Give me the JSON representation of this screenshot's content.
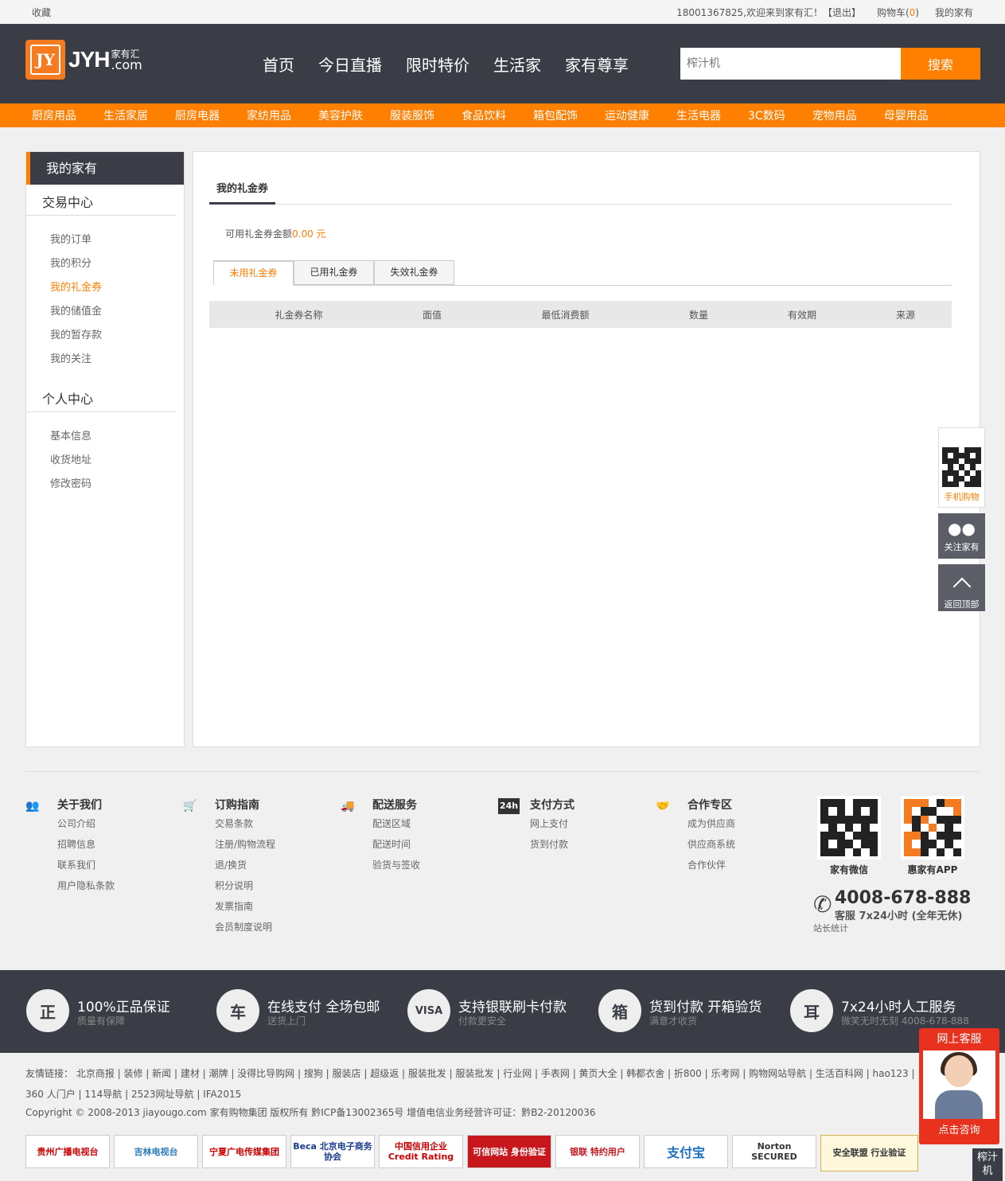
{
  "topbar": {
    "favorite": "收藏",
    "welcome": "18001367825,欢迎来到家有汇！",
    "logout": "【退出】",
    "cart_label": "购物车(",
    "cart_count": "0",
    "cart_close": ")",
    "my_account": "我的家有"
  },
  "header": {
    "logo_mark": "JY",
    "logo_text": "JYH",
    "logo_cn": "家有汇",
    "logo_com": ".com",
    "nav": [
      "首页",
      "今日直播",
      "限时特价",
      "生活家",
      "家有尊享"
    ],
    "search_placeholder": "榨汁机",
    "search_button": "搜索"
  },
  "categories": [
    "厨房用品",
    "生活家居",
    "厨房电器",
    "家纺用品",
    "美容护肤",
    "服装服饰",
    "食品饮料",
    "箱包配饰",
    "运动健康",
    "生活电器",
    "3C数码",
    "宠物用品",
    "母婴用品"
  ],
  "sidebar": {
    "title": "我的家有",
    "trade_center": "交易中心",
    "trade_items": [
      "我的订单",
      "我的积分",
      "我的礼金券",
      "我的储值金",
      "我的暂存款",
      "我的关注"
    ],
    "personal_center": "个人中心",
    "personal_items": [
      "基本信息",
      "收货地址",
      "修改密码"
    ]
  },
  "content": {
    "tab": "我的礼金券",
    "balance_label": "可用礼金券金额",
    "balance_value": "0.00 元",
    "sub_tabs": [
      "未用礼金券",
      "已用礼金券",
      "失效礼金券"
    ],
    "columns": [
      "礼金券名称",
      "面值",
      "最低消费额",
      "数量",
      "有效期",
      "来源"
    ]
  },
  "float": {
    "mobile": "手机购物",
    "follow": "关注家有",
    "back_top": "返回顶部"
  },
  "footer": {
    "cols": [
      {
        "title": "关于我们",
        "icon": "people-icon",
        "items": [
          "公司介绍",
          "招聘信息",
          "联系我们",
          "用户隐私条款"
        ]
      },
      {
        "title": "订购指南",
        "icon": "cart-icon",
        "items": [
          "交易条款",
          "注册/购物流程",
          "退/换货",
          "积分说明",
          "发票指南",
          "会员制度说明"
        ]
      },
      {
        "title": "配送服务",
        "icon": "truck-icon",
        "items": [
          "配送区域",
          "配送时间",
          "验货与签收"
        ]
      },
      {
        "title": "支付方式",
        "icon": "24h-icon",
        "items": [
          "网上支付",
          "货到付款"
        ]
      },
      {
        "title": "合作专区",
        "icon": "partner-icon",
        "items": [
          "成为供应商",
          "供应商系统",
          "合作伙伴"
        ]
      }
    ],
    "qr1": "家有微信",
    "qr2": "惠家有APP",
    "hotline": "4008-678-888",
    "hotline_desc": "客服 7x24小时 (全年无休)",
    "stat": "站长统计"
  },
  "services": [
    {
      "icon": "正",
      "title": "100%正品保证",
      "sub": "质量有保障"
    },
    {
      "icon": "车",
      "title": "在线支付 全场包邮",
      "sub": "送货上门"
    },
    {
      "icon": "VISA",
      "title": "支持银联刷卡付款",
      "sub": "付款更安全"
    },
    {
      "icon": "箱",
      "title": "货到付款 开箱验货",
      "sub": "满意才收货"
    },
    {
      "icon": "耳",
      "title": "7x24小时人工服务",
      "sub": "微笑无时无刻 4008-678-888"
    }
  ],
  "bottom": {
    "friends": "友情链接：  北京商报 | 装修 | 新闻 | 建材 | 潮牌 | 没得比导购网 | 搜狗 | 服装店 | 超级返 | 服装批发 | 服装批发 | 行业网 | 手表网 | 黄页大全 | 韩都衣舍 | 折800 | 乐考网 | 购物网站导航 | 生活百科网 | hao123 | 360 人门户 | 114导航 | 2523网址导航 | IFA2015",
    "copyright": "Copyright © 2008-2013 jiayougo.com 家有购物集团 版权所有 黔ICP备13002365号 增值电信业务经营许可证：黔B2-20120036",
    "badges": [
      "贵州广播电视台",
      "吉林电视台",
      "宁夏广电传媒集团",
      "Beca 北京电子商务协会",
      "中国信用企业 Credit Rating",
      "可信网站 身份验证",
      "银联 特约用户",
      "支付宝",
      "Norton SECURED",
      "安全联盟 行业验证"
    ]
  },
  "kefu": {
    "title": "网上客服",
    "button": "点击咨询"
  },
  "tag": "榨汁机"
}
